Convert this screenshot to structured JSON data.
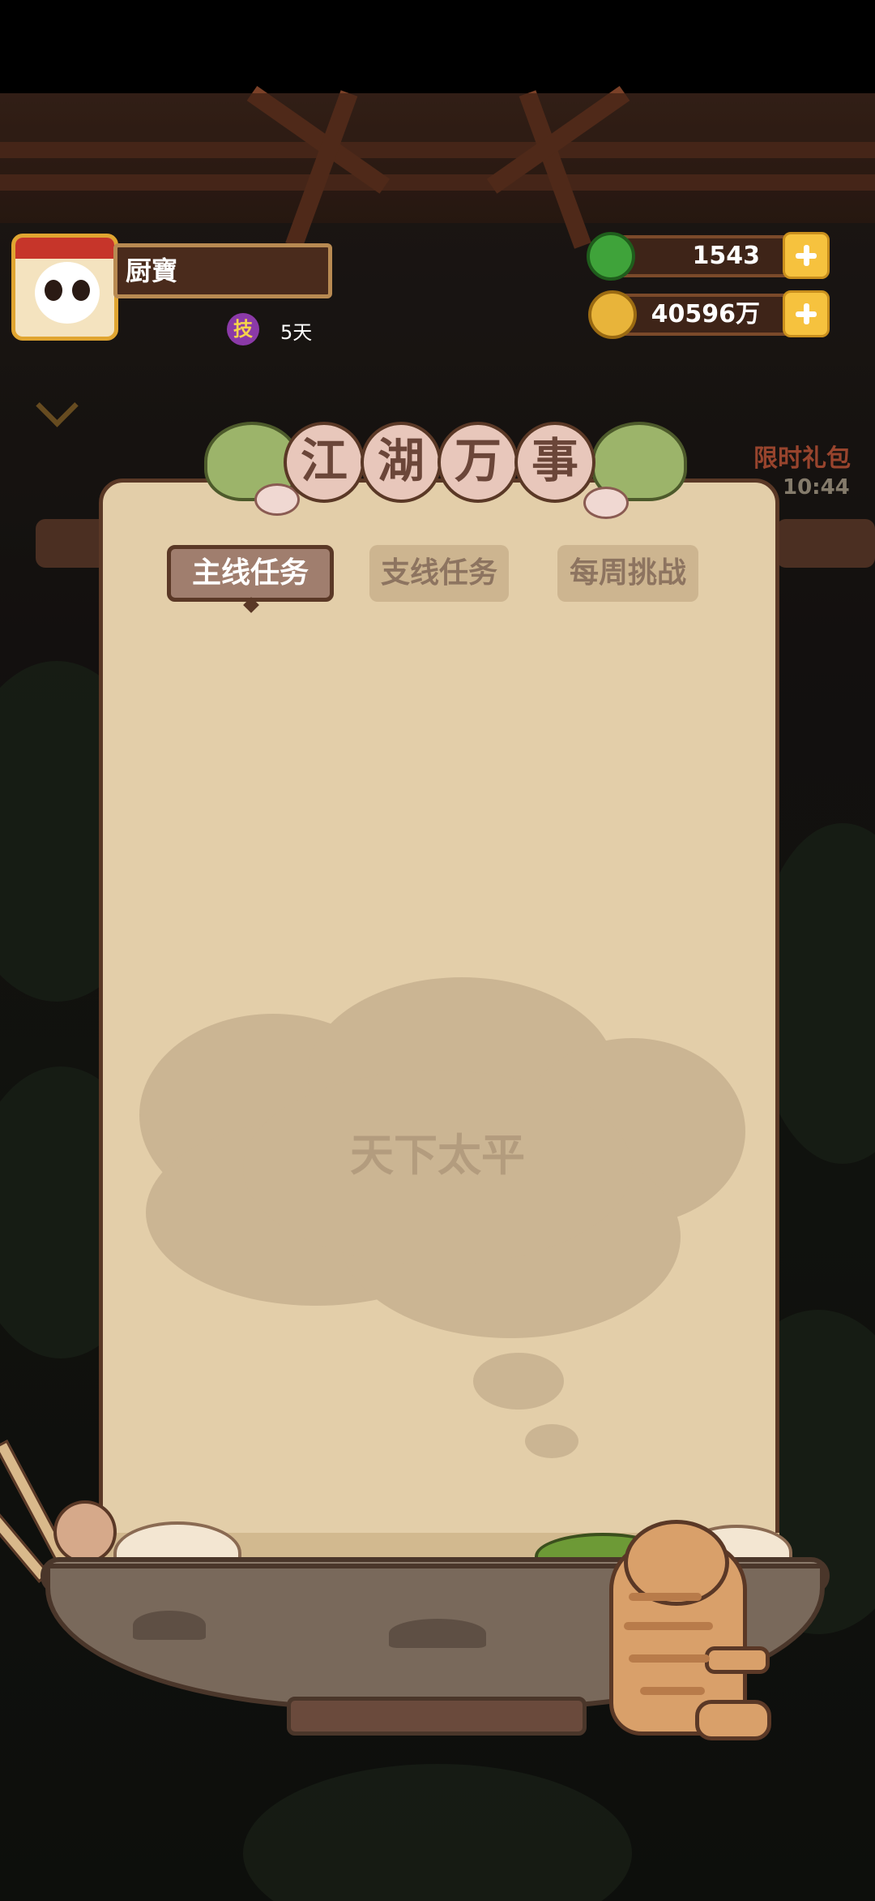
{
  "player": {
    "name": "厨寶",
    "skill_badge": "技",
    "days": "5天"
  },
  "resources": {
    "jade": "1543",
    "coins": "40596万"
  },
  "side_offer": {
    "label": "限时礼包",
    "timer": "10:44"
  },
  "panel": {
    "title_chars": [
      "江",
      "湖",
      "万",
      "事"
    ],
    "tabs": [
      {
        "label": "主线任务",
        "active": true
      },
      {
        "label": "支线任务",
        "active": false
      },
      {
        "label": "每周挑战",
        "active": false
      }
    ],
    "empty_message": "天下太平"
  },
  "colors": {
    "paper": "#e3cea9",
    "border": "#5a3826",
    "accent_gold": "#f6c23e",
    "jade_green": "#3fa33a"
  }
}
